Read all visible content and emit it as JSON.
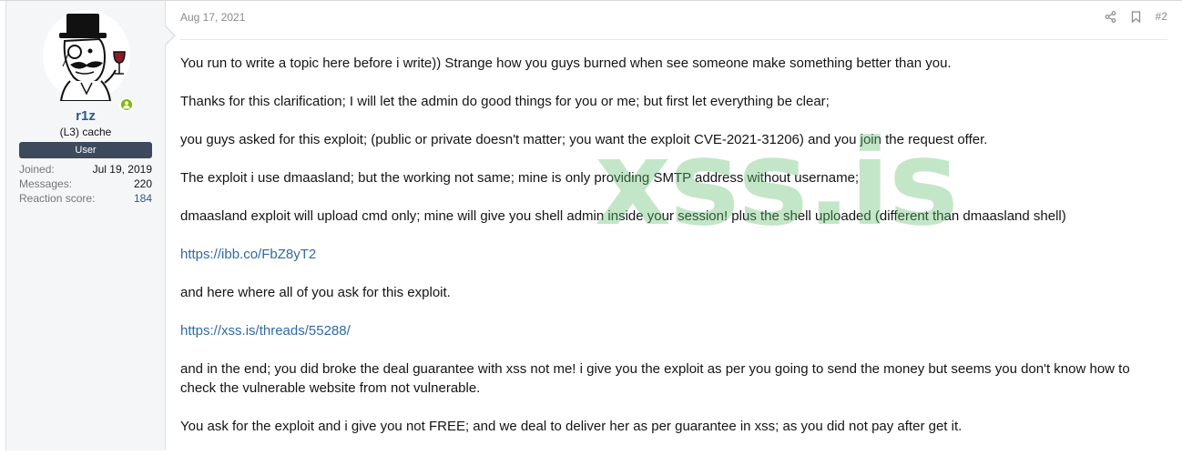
{
  "user": {
    "name": "r1z",
    "title": "(L3) cache",
    "banner": "User",
    "stats": [
      {
        "label": "Joined:",
        "value": "Jul 19, 2019"
      },
      {
        "label": "Messages:",
        "value": "220"
      },
      {
        "label": "Reaction score:",
        "value": "184"
      }
    ]
  },
  "post": {
    "date": "Aug 17, 2021",
    "number": "#2",
    "paragraphs": [
      "You run to write a topic here before i write)) Strange how you guys burned when see someone make something better than you.",
      "Thanks for this clarification; I will let the admin do good things for you or me; but first let everything be clear;",
      "you guys asked for this exploit; (public or private doesn't matter; you want the exploit CVE-2021-31206) and you join the request offer.",
      "The exploit i use dmaasland; but the working not same; mine is only providing SMTP address without username;",
      "dmaasland exploit will upload cmd only; mine will give you shell admin inside your session! plus the shell uploaded (different than dmaasland shell)"
    ],
    "link1": "https://ibb.co/FbZ8yT2",
    "paragraph_mid": "and here where all of you ask for this exploit.",
    "link2": "https://xss.is/threads/55288/",
    "paragraphs_end": [
      "and in the end; you did broke the deal guarantee with xss not me! i give you the exploit as per you going to send the money but seems you don't know how to check the vulnerable website from not vulnerable.",
      "You ask for the exploit and i give you not FREE; and we deal to deliver her as per guarantee in xss; as you did not pay after get it."
    ]
  },
  "watermark": "xss.is",
  "icons": {
    "share": "share-icon",
    "bookmark": "bookmark-icon",
    "online": "online-status-icon"
  },
  "colors": {
    "username": "#2b5a8a",
    "banner": "#3c4a5c",
    "link": "#2f6aa3",
    "online": "#7fb900",
    "watermark": "#64be6e"
  }
}
